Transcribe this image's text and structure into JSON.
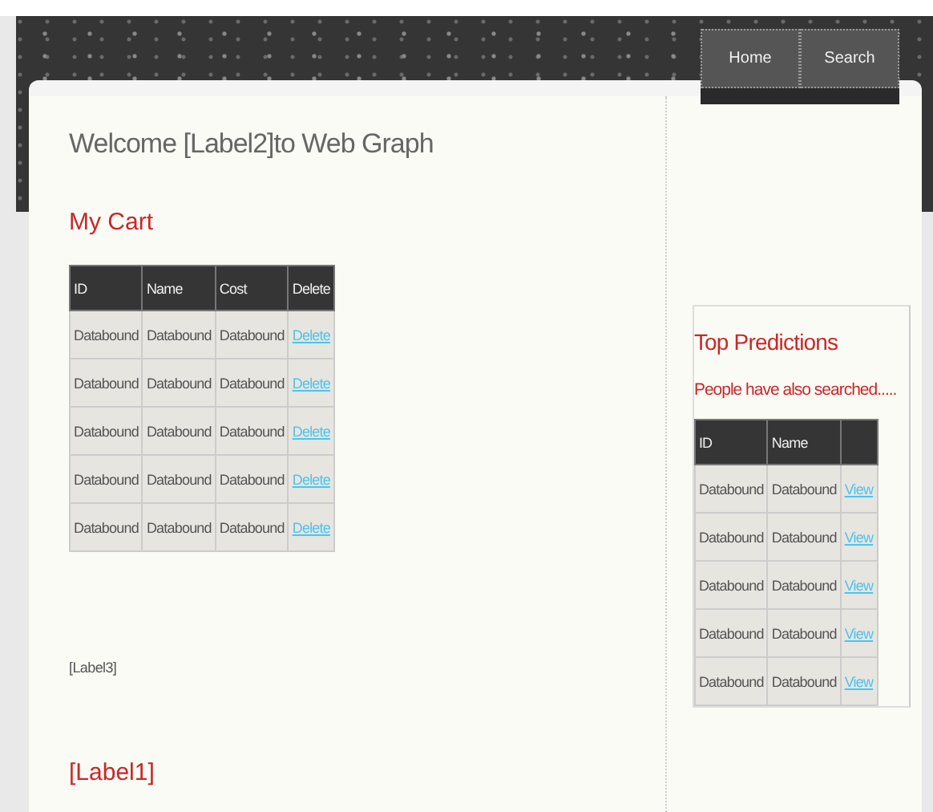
{
  "nav": [
    {
      "label": "Home"
    },
    {
      "label": "Search"
    }
  ],
  "welcome": "Welcome [Label2]to Web Graph",
  "cart": {
    "title": "My Cart",
    "columns": [
      "ID",
      "Name",
      "Cost",
      "Delete"
    ],
    "rows": [
      {
        "cells": [
          "Databound",
          "Databound",
          "Databound"
        ],
        "action": "Delete"
      },
      {
        "cells": [
          "Databound",
          "Databound",
          "Databound"
        ],
        "action": "Delete"
      },
      {
        "cells": [
          "Databound",
          "Databound",
          "Databound"
        ],
        "action": "Delete"
      },
      {
        "cells": [
          "Databound",
          "Databound",
          "Databound"
        ],
        "action": "Delete"
      },
      {
        "cells": [
          "Databound",
          "Databound",
          "Databound"
        ],
        "action": "Delete"
      }
    ]
  },
  "label3": "[Label3]",
  "label1": "[Label1]",
  "predictions": {
    "title": "Top Predictions",
    "subtitle": "People have also searched.....",
    "columns": [
      "ID",
      "Name"
    ],
    "rows": [
      {
        "cells": [
          "Databound",
          "Databound"
        ],
        "action": "View"
      },
      {
        "cells": [
          "Databound",
          "Databound"
        ],
        "action": "View"
      },
      {
        "cells": [
          "Databound",
          "Databound"
        ],
        "action": "View"
      },
      {
        "cells": [
          "Databound",
          "Databound"
        ],
        "action": "View"
      },
      {
        "cells": [
          "Databound",
          "Databound"
        ],
        "action": "View"
      }
    ]
  }
}
